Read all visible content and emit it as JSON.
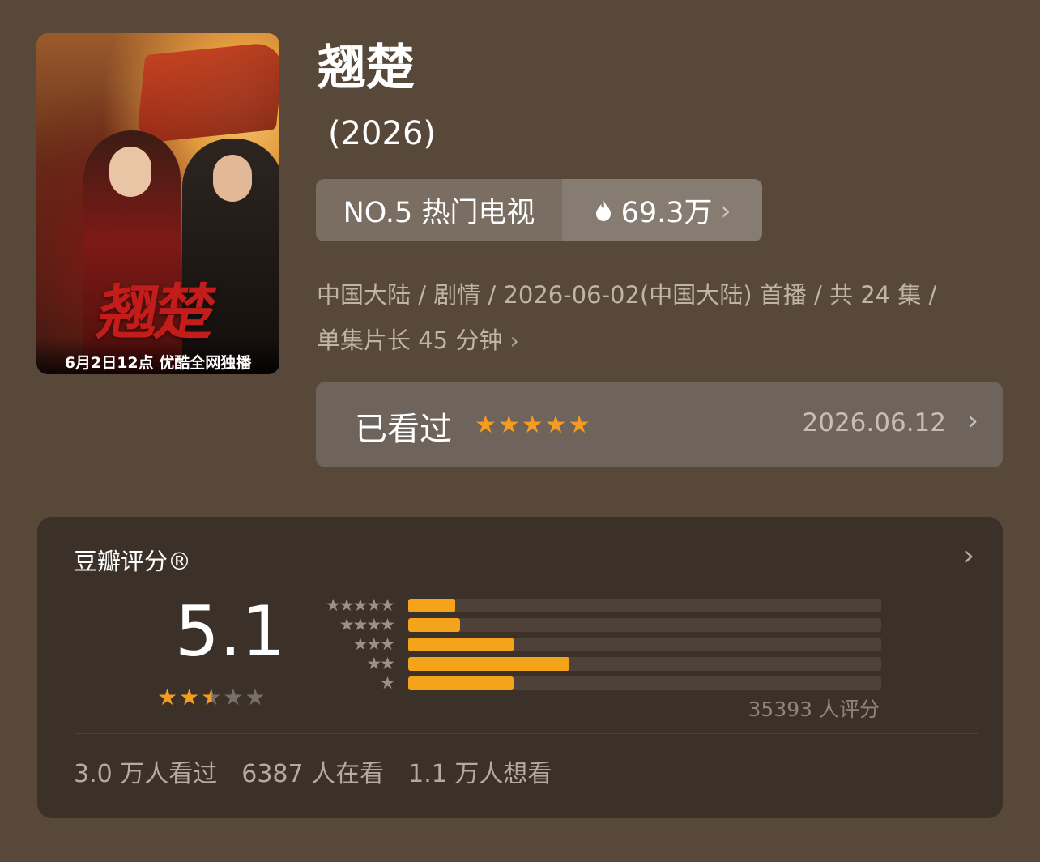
{
  "poster": {
    "caption": "6月2日12点 优酷全网独播",
    "calligraphy": "翘楚"
  },
  "title": "翘楚",
  "year": "(2026)",
  "rank": {
    "label": "NO.5 热门电视",
    "heat": "69.3万"
  },
  "meta": {
    "line1": "中国大陆 / 剧情 / 2026-06-02(中国大陆) 首播 / 共 24 集 /",
    "line2": "单集片长 45 分钟"
  },
  "watched": {
    "label": "已看过",
    "stars": 5,
    "date": "2026.06.12"
  },
  "rating": {
    "brand": "豆瓣评分®",
    "score": "5.1",
    "stars": 2.5,
    "distribution": [
      {
        "stars": 5,
        "percent": 10.0
      },
      {
        "stars": 4,
        "percent": 11.0
      },
      {
        "stars": 3,
        "percent": 22.3
      },
      {
        "stars": 2,
        "percent": 34.0
      },
      {
        "stars": 1,
        "percent": 22.2
      }
    ],
    "count": "35393 人评分"
  },
  "stats": {
    "watched": "3.0 万人看过",
    "watching": "6387 人在看",
    "want": "1.1 万人想看"
  },
  "colors": {
    "accent": "#f39c21",
    "bar": "#f5a31a",
    "background": "#57483a",
    "card": "#3c3129"
  }
}
